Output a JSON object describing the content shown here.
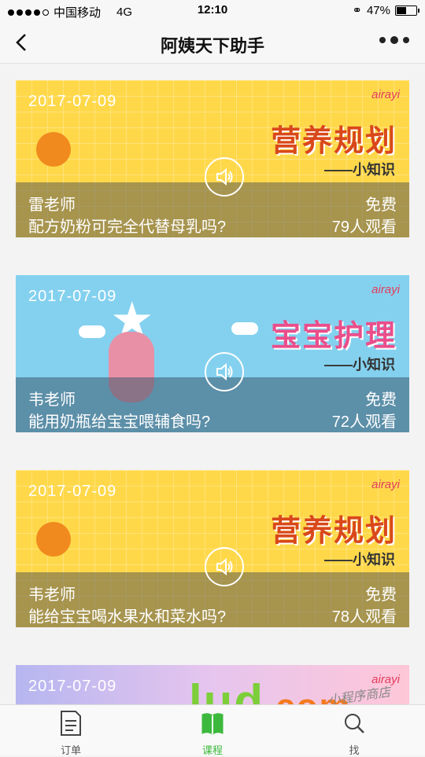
{
  "status_bar": {
    "carrier": "中国移动",
    "network": "4G",
    "time": "12:10",
    "battery": "47%"
  },
  "nav": {
    "title": "阿姨天下助手",
    "back_icon": "chevron-left-icon",
    "more_icon": "more-dots-icon"
  },
  "cards": [
    {
      "date": "2017-07-09",
      "brand": "airayi",
      "banner_title": "营养规划",
      "banner_sub": "——小知识",
      "teacher": "雷老师",
      "question": "配方奶粉可完全代替母乳吗?",
      "price": "免费",
      "views": "79人观看"
    },
    {
      "date": "2017-07-09",
      "brand": "airayi",
      "banner_title": "宝宝护理",
      "banner_sub": "——小知识",
      "teacher": "韦老师",
      "question": "能用奶瓶给宝宝喂辅食吗?",
      "price": "免费",
      "views": "72人观看"
    },
    {
      "date": "2017-07-09",
      "brand": "airayi",
      "banner_title": "营养规划",
      "banner_sub": "——小知识",
      "teacher": "韦老师",
      "question": "能给宝宝喝水果水和菜水吗?",
      "price": "免费",
      "views": "78人观看"
    },
    {
      "date": "2017-07-09",
      "brand": "airayi"
    }
  ],
  "tabs": [
    {
      "label": "订单",
      "icon": "document-icon"
    },
    {
      "label": "课程",
      "icon": "book-icon"
    },
    {
      "label": "找",
      "icon": "search-icon"
    }
  ],
  "watermark": {
    "main": "lud",
    "suffix": ".com",
    "note": "小程序商店"
  },
  "colors": {
    "active_tab": "#3cb93c",
    "yellow_card": "#ffd84a",
    "blue_card": "#84d1ef"
  }
}
